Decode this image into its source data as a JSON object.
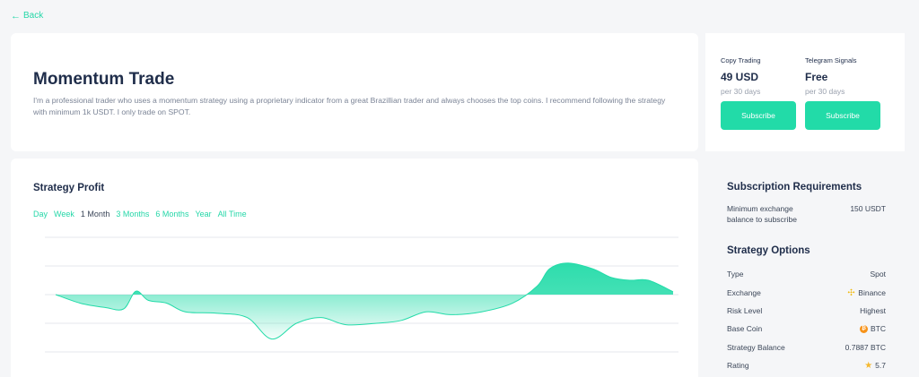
{
  "nav": {
    "back_label": "Back"
  },
  "strategy": {
    "title": "Momentum Trade",
    "description": "I'm a professional trader who uses a momentum strategy using a proprietary indicator from a great Brazillian trader and always chooses the top coins. I recommend following the strategy with minimum 1k USDT. I only trade on SPOT."
  },
  "plans": [
    {
      "name": "Copy Trading",
      "price": "49 USD",
      "period": "per 30 days",
      "button": "Subscribe"
    },
    {
      "name": "Telegram Signals",
      "price": "Free",
      "period": "per 30 days",
      "button": "Subscribe"
    }
  ],
  "profit": {
    "title": "Strategy Profit",
    "ranges": [
      "Day",
      "Week",
      "1 Month",
      "3 Months",
      "6 Months",
      "Year",
      "All Time"
    ],
    "active_range": "1 Month"
  },
  "requirements": {
    "title": "Subscription Requirements",
    "rows": [
      {
        "label": "Minimum exchange balance to subscribe",
        "value": "150 USDT"
      }
    ]
  },
  "options": {
    "title": "Strategy Options",
    "rows": [
      {
        "label": "Type",
        "value": "Spot",
        "icon": ""
      },
      {
        "label": "Exchange",
        "value": "Binance",
        "icon": "binance-icon"
      },
      {
        "label": "Risk Level",
        "value": "Highest",
        "icon": ""
      },
      {
        "label": "Base Coin",
        "value": "BTC",
        "icon": "bitcoin-icon"
      },
      {
        "label": "Strategy Balance",
        "value": "0.7887 BTC",
        "icon": ""
      },
      {
        "label": "Rating",
        "value": "5.7",
        "icon": "star-icon"
      }
    ]
  },
  "colors": {
    "accent": "#22dba8",
    "text": "#1f2d4a",
    "muted": "#7b8496",
    "bitcoin": "#f7931a",
    "binance": "#f0b90b",
    "star": "#f5b82e"
  },
  "chart_data": {
    "type": "area",
    "x": [
      0,
      0.04,
      0.08,
      0.11,
      0.13,
      0.15,
      0.18,
      0.21,
      0.26,
      0.31,
      0.35,
      0.39,
      0.43,
      0.47,
      0.52,
      0.56,
      0.6,
      0.64,
      0.69,
      0.74,
      0.78,
      0.8,
      0.83,
      0.87,
      0.9,
      0.93,
      0.96,
      1.0
    ],
    "values": [
      0,
      -0.3,
      -0.45,
      -0.5,
      0.12,
      -0.2,
      -0.3,
      -0.6,
      -0.65,
      -0.8,
      -1.55,
      -1.0,
      -0.8,
      -1.05,
      -1.0,
      -0.9,
      -0.6,
      -0.7,
      -0.6,
      -0.3,
      0.3,
      0.9,
      1.1,
      0.9,
      0.6,
      0.5,
      0.5,
      0.1
    ],
    "ylim": [
      -2,
      2
    ],
    "grid": true
  }
}
